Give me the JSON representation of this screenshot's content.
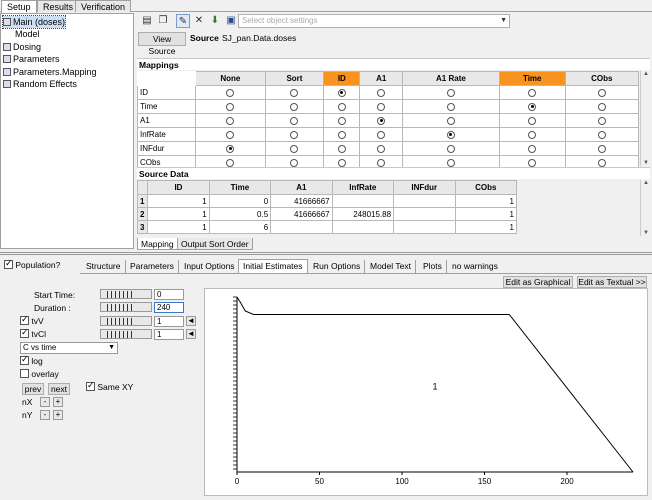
{
  "top_tabs": [
    "Setup",
    "Results",
    "Verification"
  ],
  "tree": [
    "Main (doses)",
    "Model",
    "Dosing",
    "Parameters",
    "Parameters.Mapping",
    "Random Effects"
  ],
  "toolbar": {
    "icons": [
      "open-folder-icon",
      "copy-icon",
      "edit-icon",
      "close-icon",
      "download-icon",
      "save-icon"
    ],
    "object_settings_placeholder": "Select object settings"
  },
  "source": {
    "button": "View Source",
    "label": "Source",
    "value": "SJ_pan.Data.doses"
  },
  "mappings": {
    "title": "Mappings",
    "columns": [
      "None",
      "Sort",
      "ID",
      "A1",
      "A1 Rate",
      "Time",
      "CObs"
    ],
    "highlighted": [
      "ID",
      "Time"
    ],
    "rows": [
      {
        "label": "ID",
        "selected": 2
      },
      {
        "label": "Time",
        "selected": 5
      },
      {
        "label": "A1",
        "selected": 3
      },
      {
        "label": "InfRate",
        "selected": 4
      },
      {
        "label": "INFdur",
        "selected": 0
      },
      {
        "label": "CObs",
        "selected": -1
      }
    ]
  },
  "source_data": {
    "title": "Source Data",
    "columns": [
      "ID",
      "Time",
      "A1",
      "InfRate",
      "INFdur",
      "CObs"
    ],
    "rows": [
      {
        "n": "1",
        "cells": [
          "1",
          "0",
          "41666667",
          "",
          "",
          "1"
        ]
      },
      {
        "n": "2",
        "cells": [
          "1",
          "0.5",
          "41666667",
          "248015.88",
          "",
          "1"
        ]
      },
      {
        "n": "3",
        "cells": [
          "1",
          "6",
          "",
          "",
          "",
          "1"
        ]
      }
    ]
  },
  "bottom_tabs": [
    "Mapping",
    "Output Sort Order"
  ],
  "population": {
    "label": "Population?",
    "checked": true
  },
  "lower_tabs": [
    "Structure",
    "Parameters",
    "Input Options",
    "Initial Estimates",
    "Run Options",
    "Model Text",
    "Plots",
    "no warnings"
  ],
  "lower_active_tab": "Initial Estimates",
  "edit_buttons": [
    "Edit as Graphical >>",
    "Edit as Textual >>"
  ],
  "controls": {
    "start_time": {
      "label": "Start Time:",
      "value": "0"
    },
    "duration": {
      "label": "Duration :",
      "value": "240"
    },
    "tvV": {
      "label": "tvV",
      "value": "1",
      "checked": true
    },
    "tvCl": {
      "label": "tvCl",
      "value": "1",
      "checked": true
    },
    "plot_select": "C vs time",
    "log": {
      "label": "log",
      "checked": true
    },
    "overlay": {
      "label": "overlay",
      "checked": false
    },
    "prev": "prev",
    "next": "next",
    "same_xy": {
      "label": "Same XY",
      "checked": true
    },
    "nX": "nX",
    "nY": "nY",
    "minus": "-",
    "plus": "+"
  },
  "chart_data": {
    "type": "line",
    "title": "",
    "xlabel": "",
    "ylabel": "",
    "xlim": [
      0,
      240
    ],
    "x_ticks": [
      "0",
      "50",
      "100",
      "150",
      "200"
    ],
    "center_label": "1",
    "series": [
      {
        "x": [
          0,
          2,
          5,
          10,
          165,
          240
        ],
        "y": [
          1.0,
          0.97,
          0.92,
          0.9,
          0.9,
          0.0
        ]
      }
    ]
  }
}
